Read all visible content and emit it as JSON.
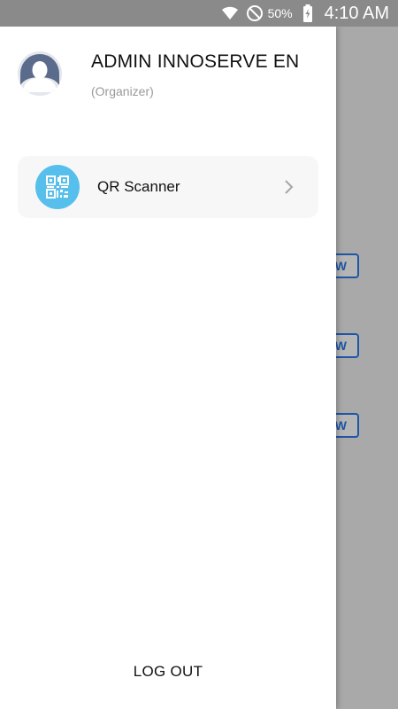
{
  "status_bar": {
    "battery_percent": "50%",
    "time": "4:10 AM",
    "icons": [
      "wifi-icon",
      "do-not-disturb-icon",
      "battery-charging-icon"
    ]
  },
  "background": {
    "view_buttons": [
      "W",
      "W",
      "W"
    ]
  },
  "drawer": {
    "user_name": "ADMIN INNOSERVE EN",
    "user_role": "(Organizer)",
    "menu_items": [
      {
        "label": "QR Scanner",
        "icon": "qr-code-icon"
      }
    ],
    "logout_label": "LOG OUT"
  },
  "colors": {
    "accent_blue": "#57bfec",
    "button_blue": "#1e56a8",
    "avatar_dark": "#5a6b8c"
  }
}
